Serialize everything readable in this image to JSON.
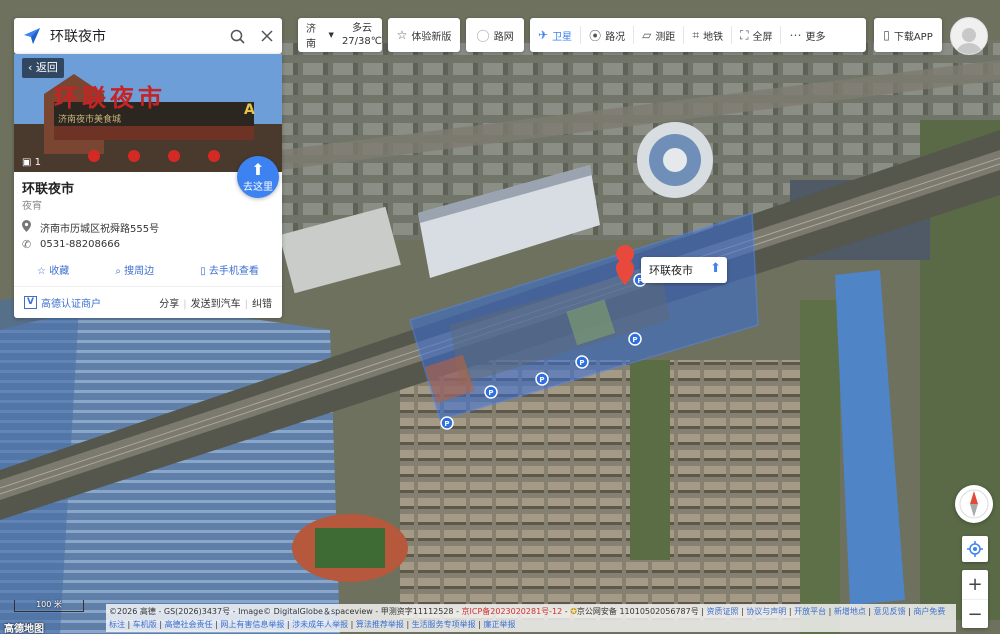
{
  "search": {
    "query": "环联夜市"
  },
  "poi": {
    "back_label": "返回",
    "photo_count": "1",
    "photo_sign": "环联夜市",
    "photo_sign_sub": "济南夜市美食城",
    "photo_sign_letter": "A",
    "goto_label": "去这里",
    "name": "环联夜市",
    "category": "夜宵",
    "address": "济南市历城区祝舜路555号",
    "phone": "0531-88208666",
    "actions": {
      "favorite": "收藏",
      "nearby": "搜周边",
      "phone_view": "去手机查看"
    },
    "certified": "高德认证商户",
    "cert_mark": "V",
    "share": "分享",
    "send_to_car": "发送到汽车",
    "correct": "纠错"
  },
  "toolbar": {
    "city": "济南",
    "weather": "多云",
    "temperature": "27/38℃",
    "new_version": "体验新版",
    "road_network": "路网",
    "tools": {
      "satellite": "卫星",
      "traffic": "路况",
      "measure": "测距",
      "subway": "地铁",
      "fullscreen": "全屏",
      "more": "更多"
    },
    "download": "下载APP"
  },
  "marker": {
    "label": "环联夜市"
  },
  "map": {
    "scale": "100 米",
    "brand": "高德地图",
    "copyright": {
      "main": "©2026 高德 - GS(2026)3437号 - Image© DigitalGlobe＆spaceview - 甲测资字11112528 - ",
      "icp": "京ICP备2023020281号-12",
      "sep": " - ",
      "police": "京公网安备 11010502056787号",
      "links": [
        "资质证照",
        "协议与声明",
        "开放平台",
        "新增地点",
        "意见反馈",
        "商户免费标注",
        "车机版",
        "高德社会责任",
        "网上有害信息举报",
        "涉未成年人举报",
        "算法推荐举报",
        "生活服务专项举报",
        "廉正举报"
      ]
    }
  },
  "colors": {
    "accent": "#3c82f0",
    "marker": "#e8493c",
    "highlight": "#3a6fd8"
  }
}
